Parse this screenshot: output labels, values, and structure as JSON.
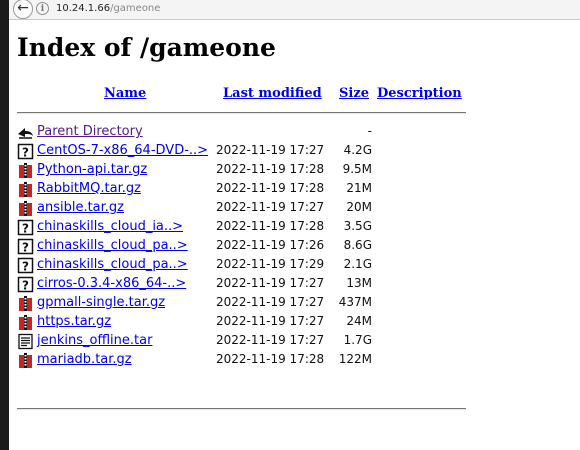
{
  "browser": {
    "url_host": "10.24.1.66",
    "url_path": "/gameone"
  },
  "page": {
    "title": "Index of /gameone"
  },
  "table": {
    "headers": {
      "name": "Name",
      "last_modified": "Last modified",
      "size": "Size",
      "description": "Description"
    },
    "rows": [
      {
        "icon": "back",
        "name": "Parent Directory",
        "modified": "",
        "size": "-"
      },
      {
        "icon": "unknown",
        "name": "CentOS-7-x86_64-DVD-..>",
        "modified": "2022-11-19 17:27",
        "size": "4.2G"
      },
      {
        "icon": "compressed",
        "name": "Python-api.tar.gz",
        "modified": "2022-11-19 17:28",
        "size": "9.5M"
      },
      {
        "icon": "compressed",
        "name": "RabbitMQ.tar.gz",
        "modified": "2022-11-19 17:28",
        "size": "21M"
      },
      {
        "icon": "compressed",
        "name": "ansible.tar.gz",
        "modified": "2022-11-19 17:27",
        "size": "20M"
      },
      {
        "icon": "unknown",
        "name": "chinaskills_cloud_ia..>",
        "modified": "2022-11-19 17:28",
        "size": "3.5G"
      },
      {
        "icon": "unknown",
        "name": "chinaskills_cloud_pa..>",
        "modified": "2022-11-19 17:26",
        "size": "8.6G"
      },
      {
        "icon": "unknown",
        "name": "chinaskills_cloud_pa..>",
        "modified": "2022-11-19 17:29",
        "size": "2.1G"
      },
      {
        "icon": "unknown",
        "name": "cirros-0.3.4-x86_64-..>",
        "modified": "2022-11-19 17:27",
        "size": "13M"
      },
      {
        "icon": "compressed",
        "name": "gpmall-single.tar.gz",
        "modified": "2022-11-19 17:27",
        "size": "437M"
      },
      {
        "icon": "compressed",
        "name": "https.tar.gz",
        "modified": "2022-11-19 17:27",
        "size": "24M"
      },
      {
        "icon": "text",
        "name": "jenkins_offline.tar",
        "modified": "2022-11-19 17:27",
        "size": "1.7G"
      },
      {
        "icon": "compressed",
        "name": "mariadb.tar.gz",
        "modified": "2022-11-19 17:28",
        "size": "122M"
      }
    ]
  }
}
